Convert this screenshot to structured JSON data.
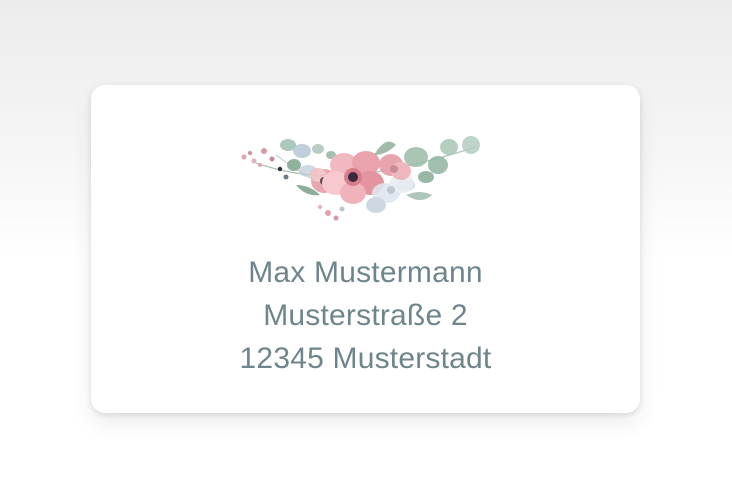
{
  "address_label": {
    "name": "Max Mustermann",
    "street": "Musterstraße 2",
    "city_line": "12345 Musterstadt"
  },
  "colors": {
    "text": "#6f858c",
    "card_background": "#ffffff",
    "flower_pink": "#e9a9b0",
    "flower_center": "#3a2a3a",
    "leaf_green": "#7fa58f",
    "leaf_blue_grey": "#a9bcc8"
  },
  "decoration": {
    "icon": "watercolor-floral-wreath-icon"
  }
}
